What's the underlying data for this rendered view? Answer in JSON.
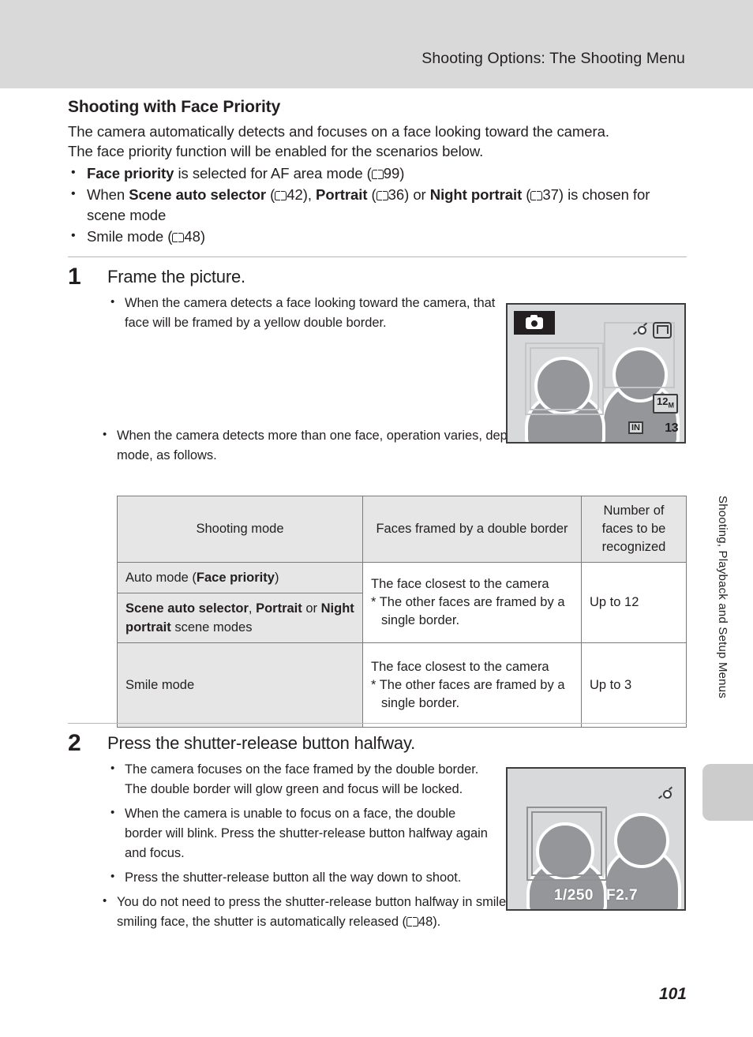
{
  "header": {
    "title": "Shooting Options: The Shooting Menu"
  },
  "section": {
    "title": "Shooting with Face Priority",
    "intro_line1": "The camera automatically detects and focuses on a face looking toward the camera.",
    "intro_line2": "The face priority function will be enabled for the scenarios below.",
    "bullets": [
      {
        "parts": [
          {
            "text": "Face priority",
            "bold": true
          },
          {
            "text": " is selected for AF area mode (",
            "bold": false
          },
          {
            "icon": "book-icon"
          },
          {
            "text": "99)",
            "bold": false
          }
        ]
      },
      {
        "parts": [
          {
            "text": "When ",
            "bold": false
          },
          {
            "text": "Scene auto selector",
            "bold": true
          },
          {
            "text": " (",
            "bold": false
          },
          {
            "icon": "book-icon"
          },
          {
            "text": "42), ",
            "bold": false
          },
          {
            "text": "Portrait",
            "bold": true
          },
          {
            "text": " (",
            "bold": false
          },
          {
            "icon": "book-icon"
          },
          {
            "text": "36) or ",
            "bold": false
          },
          {
            "text": "Night portrait",
            "bold": true
          },
          {
            "text": " (",
            "bold": false
          },
          {
            "icon": "book-icon"
          },
          {
            "text": "37) is chosen for scene mode",
            "bold": false
          }
        ]
      },
      {
        "parts": [
          {
            "text": "Smile mode (",
            "bold": false
          },
          {
            "icon": "book-icon"
          },
          {
            "text": "48)",
            "bold": false
          }
        ]
      }
    ]
  },
  "step1": {
    "number": "1",
    "title": "Frame the picture.",
    "bullet1": "When the camera detects a face looking toward the camera, that face will be framed by a yellow double border.",
    "bullet2": "When the camera detects more than one face, operation varies, depending upon the shooting mode, as follows."
  },
  "lcd1": {
    "mode_icon": "camera-icon",
    "face_detect_icon": "face-detection-icon",
    "vr_icon": "vibration-reduction-icon",
    "image_size_badge": "12",
    "image_size_unit": "M",
    "memory_badge": "IN",
    "shots_remaining": "13"
  },
  "table": {
    "headers": [
      "Shooting mode",
      "Faces framed by a double border",
      "Number of faces to be recognized"
    ],
    "rows": [
      {
        "mode_parts": [
          {
            "text": "Auto mode (",
            "bold": false
          },
          {
            "text": "Face priority",
            "bold": true
          },
          {
            "text": ")",
            "bold": false
          }
        ],
        "description_line1": "The face closest to the camera",
        "description_star": "*  The other faces are framed by a single border.",
        "number": "Up to 12"
      },
      {
        "mode_parts": [
          {
            "text": "Scene auto selector",
            "bold": true
          },
          {
            "text": ", ",
            "bold": false
          },
          {
            "text": "Portrait",
            "bold": true
          },
          {
            "text": " or ",
            "bold": false
          },
          {
            "text": "Night portrait",
            "bold": true
          },
          {
            "text": " scene modes",
            "bold": false
          }
        ],
        "description_line1": "",
        "description_star": "",
        "number": ""
      },
      {
        "mode_parts": [
          {
            "text": "Smile mode",
            "bold": false
          }
        ],
        "description_line1": "The face closest to the camera",
        "description_star": "*  The other faces are framed by a single border.",
        "number": "Up to 3"
      }
    ]
  },
  "step2": {
    "number": "2",
    "title": "Press the shutter-release button halfway.",
    "bullet1": "The camera focuses on the face framed by the double border. The double border will glow green and focus will be locked.",
    "bullet2": "When the camera is unable to focus on a face, the double border will blink. Press the shutter-release button halfway again and focus.",
    "bullet3": "Press the shutter-release button all the way down to shoot.",
    "bullet4_prefix": "You do not need to press the shutter-release button halfway in smile mode. If the camera detects a smiling face, the shutter is automatically released (",
    "bullet4_suffix": "48)."
  },
  "lcd2": {
    "face_detect_icon": "face-detection-icon",
    "shutter_speed": "1/250",
    "aperture": "F2.7"
  },
  "side_label": "Shooting, Playback and Setup Menus",
  "page_number": "101",
  "colors": {
    "header_band": "#d9d9d9",
    "lcd_background": "#d7d9da",
    "figure_gray": "#949699",
    "table_shade": "#e6e6e6",
    "side_tab": "#cccccc"
  }
}
